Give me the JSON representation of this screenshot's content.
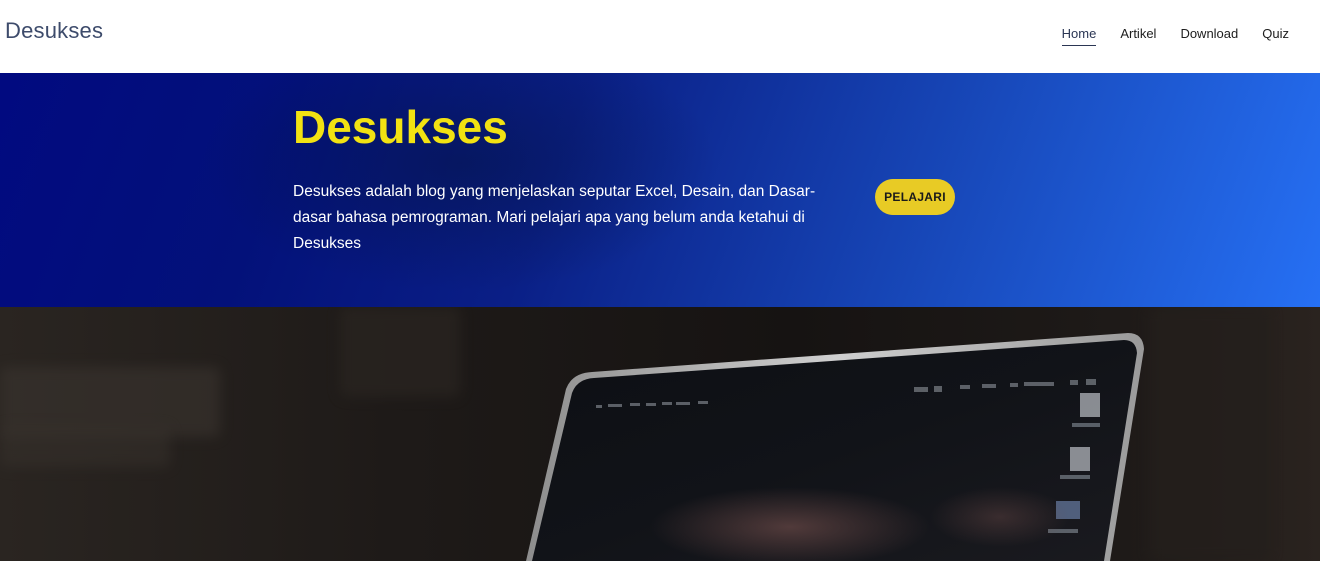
{
  "navbar": {
    "brand": "Desukses",
    "links": [
      {
        "label": "Home",
        "active": true
      },
      {
        "label": "Artikel",
        "active": false
      },
      {
        "label": "Download",
        "active": false
      },
      {
        "label": "Quiz",
        "active": false
      }
    ]
  },
  "hero": {
    "title": "Desukses",
    "description": "Desukses adalah blog yang menjelaskan seputar Excel, Desain, dan Dasar-dasar bahasa pemrograman. Mari pelajari apa yang belum anda ketahui di Desukses",
    "button_label": "PELAJARI"
  },
  "colors": {
    "title_yellow": "#f2e212",
    "button_yellow": "#e8cb25",
    "hero_gradient_start": "#010a80",
    "hero_gradient_end": "#2670f4"
  },
  "photo": {
    "icon": "laptop-photo"
  }
}
